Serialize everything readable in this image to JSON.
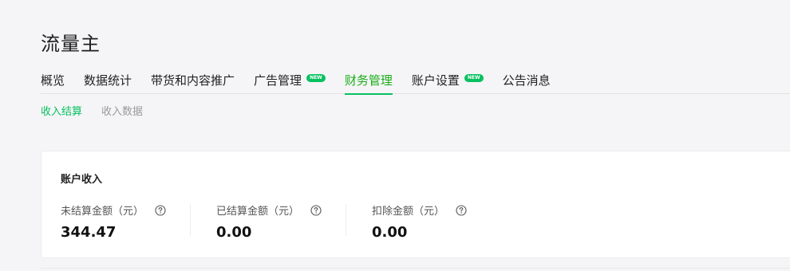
{
  "page": {
    "title": "流量主"
  },
  "tabs": [
    {
      "label": "概览",
      "active": false,
      "badge": ""
    },
    {
      "label": "数据统计",
      "active": false,
      "badge": ""
    },
    {
      "label": "带货和内容推广",
      "active": false,
      "badge": ""
    },
    {
      "label": "广告管理",
      "active": false,
      "badge": "NEW"
    },
    {
      "label": "财务管理",
      "active": true,
      "badge": ""
    },
    {
      "label": "账户设置",
      "active": false,
      "badge": "NEW"
    },
    {
      "label": "公告消息",
      "active": false,
      "badge": ""
    }
  ],
  "subtabs": [
    {
      "label": "收入结算",
      "active": true
    },
    {
      "label": "收入数据",
      "active": false
    }
  ],
  "account_card": {
    "title": "账户收入",
    "metrics": [
      {
        "label": "未结算金额（元）",
        "value": "344.47",
        "icon": "help-circle-icon"
      },
      {
        "label": "已结算金额（元）",
        "value": "0.00",
        "icon": "help-circle-icon"
      },
      {
        "label": "扣除金额（元）",
        "value": "0.00",
        "icon": "help-circle-icon"
      }
    ]
  },
  "colors": {
    "accent": "#07c160",
    "badge": "#07c160",
    "background": "#f5f5f7"
  }
}
